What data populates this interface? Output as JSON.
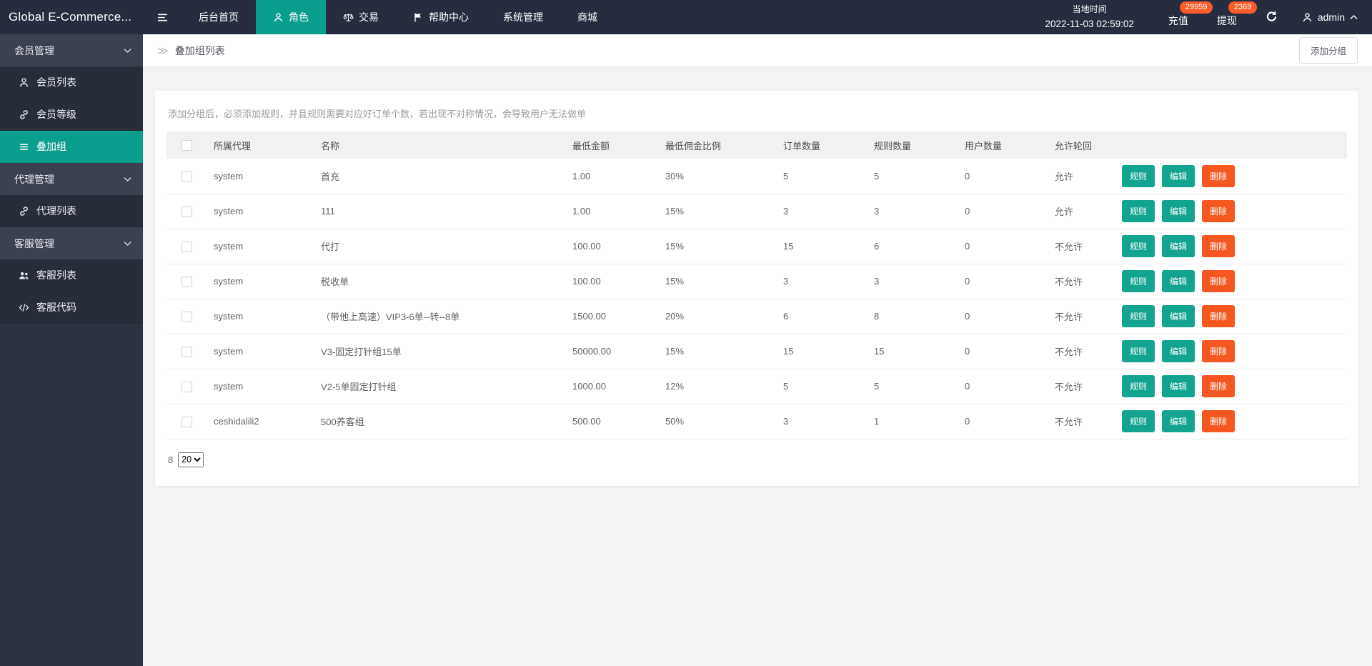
{
  "topbar": {
    "logo": "Global E-Commerce...",
    "nav": [
      {
        "key": "dashboard",
        "label": "后台首页",
        "icon": null,
        "active": false
      },
      {
        "key": "roles",
        "label": "角色",
        "icon": "person",
        "active": true
      },
      {
        "key": "trade",
        "label": "交易",
        "icon": "scales",
        "active": false
      },
      {
        "key": "help-center",
        "label": "帮助中心",
        "icon": "flag",
        "active": false
      },
      {
        "key": "system",
        "label": "系统管理",
        "icon": null,
        "active": false
      },
      {
        "key": "mall",
        "label": "商城",
        "icon": null,
        "active": false
      }
    ],
    "time": {
      "label": "当地时间",
      "value": "2022-11-03 02:59:02"
    },
    "recharge": {
      "label": "充值",
      "badge": "29959"
    },
    "withdraw": {
      "label": "提现",
      "badge": "2369"
    },
    "user": "admin"
  },
  "sidebar": {
    "items": [
      {
        "type": "group",
        "key": "member-management",
        "label": "会员管理"
      },
      {
        "type": "item",
        "key": "member-list",
        "label": "会员列表",
        "icon": "person",
        "active": false
      },
      {
        "type": "item",
        "key": "member-level",
        "label": "会员等级",
        "icon": "link",
        "active": false
      },
      {
        "type": "item",
        "key": "stack-group",
        "label": "叠加组",
        "icon": "layers",
        "active": true
      },
      {
        "type": "group",
        "key": "agent-management",
        "label": "代理管理"
      },
      {
        "type": "item",
        "key": "agent-list",
        "label": "代理列表",
        "icon": "link",
        "active": false
      },
      {
        "type": "group",
        "key": "service-management",
        "label": "客服管理"
      },
      {
        "type": "item",
        "key": "service-list",
        "label": "客服列表",
        "icon": "users",
        "active": false
      },
      {
        "type": "item",
        "key": "service-code",
        "label": "客服代码",
        "icon": "code",
        "active": false
      }
    ]
  },
  "breadcrumb": {
    "icon_glyph": "≫",
    "title": "叠加组列表"
  },
  "toolbar": {
    "add_group_label": "添加分组"
  },
  "main": {
    "hint": "添加分组后，必须添加规则，并且规则需要对应好订单个数，若出现不对称情况，会导致用户无法做单"
  },
  "table": {
    "columns": [
      "所属代理",
      "名称",
      "最低金额",
      "最低佣金比例",
      "订单数量",
      "规则数量",
      "用户数量",
      "允许轮回"
    ],
    "action_labels": {
      "rule": "规则",
      "edit": "编辑",
      "delete": "删除"
    },
    "rows": [
      {
        "agent": "system",
        "name": "首充",
        "min_amount": "1.00",
        "min_commission": "30%",
        "orders": "5",
        "rules": "5",
        "users": "0",
        "cycle": "允许"
      },
      {
        "agent": "system",
        "name": "111",
        "min_amount": "1.00",
        "min_commission": "15%",
        "orders": "3",
        "rules": "3",
        "users": "0",
        "cycle": "允许"
      },
      {
        "agent": "system",
        "name": "代打",
        "min_amount": "100.00",
        "min_commission": "15%",
        "orders": "15",
        "rules": "6",
        "users": "0",
        "cycle": "不允许"
      },
      {
        "agent": "system",
        "name": "税收单",
        "min_amount": "100.00",
        "min_commission": "15%",
        "orders": "3",
        "rules": "3",
        "users": "0",
        "cycle": "不允许"
      },
      {
        "agent": "system",
        "name": "（带他上高速）VIP3-6单--转--8单",
        "min_amount": "1500.00",
        "min_commission": "20%",
        "orders": "6",
        "rules": "8",
        "users": "0",
        "cycle": "不允许"
      },
      {
        "agent": "system",
        "name": "V3-固定打针组15单",
        "min_amount": "50000.00",
        "min_commission": "15%",
        "orders": "15",
        "rules": "15",
        "users": "0",
        "cycle": "不允许"
      },
      {
        "agent": "system",
        "name": "V2-5单固定打针组",
        "min_amount": "1000.00",
        "min_commission": "12%",
        "orders": "5",
        "rules": "5",
        "users": "0",
        "cycle": "不允许"
      },
      {
        "agent": "ceshidalili2",
        "name": "500养客组",
        "min_amount": "500.00",
        "min_commission": "50%",
        "orders": "3",
        "rules": "1",
        "users": "0",
        "cycle": "不允许"
      }
    ]
  },
  "pagination": {
    "total": "8",
    "page_sizes": [
      "20"
    ],
    "selected": "20"
  },
  "colors": {
    "topbar_bg": "#252d3e",
    "sidebar_bg": "#2d3240",
    "sidebar_group_bg": "#3c4152",
    "sidebar_item_bg": "#282d3a",
    "accent_teal": "#0a9e8c",
    "button_teal": "#12a48e",
    "button_orange": "#f4571f",
    "badge_orange": "#fa5b2a"
  }
}
